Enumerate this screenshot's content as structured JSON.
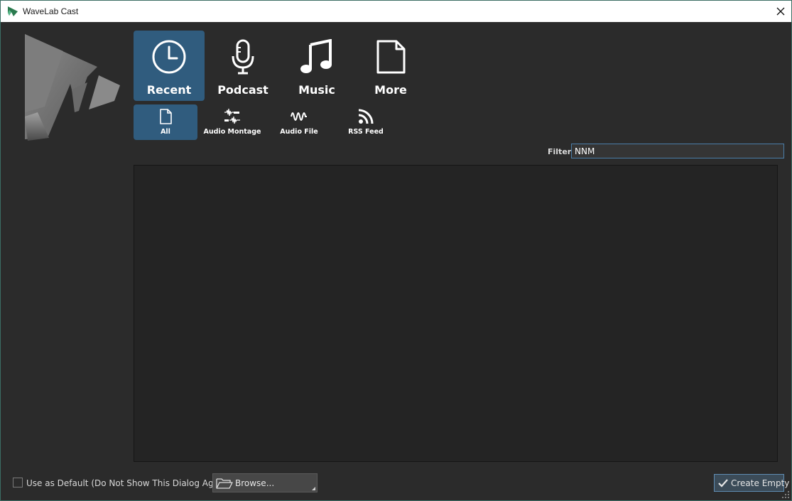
{
  "window": {
    "title": "WaveLab Cast"
  },
  "categories": [
    {
      "label": "Recent",
      "icon": "clock-icon",
      "active": true
    },
    {
      "label": "Podcast",
      "icon": "microphone-icon",
      "active": false
    },
    {
      "label": "Music",
      "icon": "music-note-icon",
      "active": false
    },
    {
      "label": "More",
      "icon": "document-icon",
      "active": false
    }
  ],
  "subcategories": [
    {
      "label": "All",
      "icon": "file-icon",
      "active": true
    },
    {
      "label": "Audio Montage",
      "icon": "audio-montage-icon",
      "active": false
    },
    {
      "label": "Audio File",
      "icon": "waveform-icon",
      "active": false
    },
    {
      "label": "RSS Feed",
      "icon": "rss-icon",
      "active": false
    }
  ],
  "filter": {
    "label": "Filter:",
    "value": "NNM"
  },
  "footer": {
    "checkbox_label": "Use as Default (Do Not Show This Dialog Again)",
    "checkbox_checked": false,
    "browse_label": "Browse...",
    "create_label": "Create Empty"
  },
  "colors": {
    "accent": "#305c7e",
    "background": "#2b2b2b",
    "list_background": "#242424"
  }
}
